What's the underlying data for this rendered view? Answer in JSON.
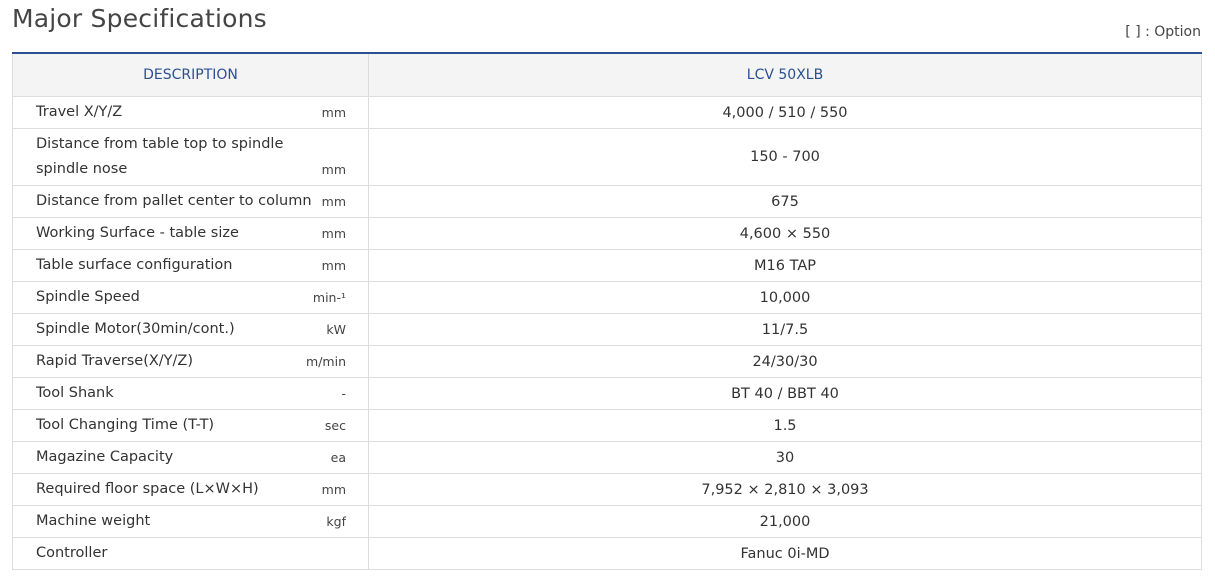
{
  "page": {
    "title": "Major Specifications",
    "option_note": "[ ] : Option"
  },
  "table": {
    "headers": {
      "description": "DESCRIPTION",
      "model": "LCV 50XLB"
    },
    "rows": [
      {
        "label": "Travel X/Y/Z",
        "unit": "mm",
        "value": "4,000 / 510 / 550"
      },
      {
        "label": "Distance from table top to spindle spindle nose",
        "unit": "mm",
        "value": "150 - 700"
      },
      {
        "label": "Distance from pallet center to column",
        "unit": "mm",
        "value": "675"
      },
      {
        "label": "Working Surface - table size",
        "unit": "mm",
        "value": "4,600 × 550"
      },
      {
        "label": "Table surface configuration",
        "unit": "mm",
        "value": "M16 TAP"
      },
      {
        "label": "Spindle Speed",
        "unit": "min-¹",
        "value": "10,000"
      },
      {
        "label": "Spindle Motor(30min/cont.)",
        "unit": "kW",
        "value": "11/7.5"
      },
      {
        "label": "Rapid Traverse(X/Y/Z)",
        "unit": "m/min",
        "value": "24/30/30"
      },
      {
        "label": "Tool Shank",
        "unit": "-",
        "value": "BT 40 / BBT 40"
      },
      {
        "label": "Tool Changing Time (T-T)",
        "unit": "sec",
        "value": "1.5"
      },
      {
        "label": "Magazine Capacity",
        "unit": "ea",
        "value": "30"
      },
      {
        "label": "Required floor space (L×W×H)",
        "unit": "mm",
        "value": "7,952 × 2,810 × 3,093"
      },
      {
        "label": "Machine weight",
        "unit": "kgf",
        "value": "21,000"
      },
      {
        "label": "Controller",
        "unit": "",
        "value": "Fanuc 0i-MD"
      }
    ]
  }
}
